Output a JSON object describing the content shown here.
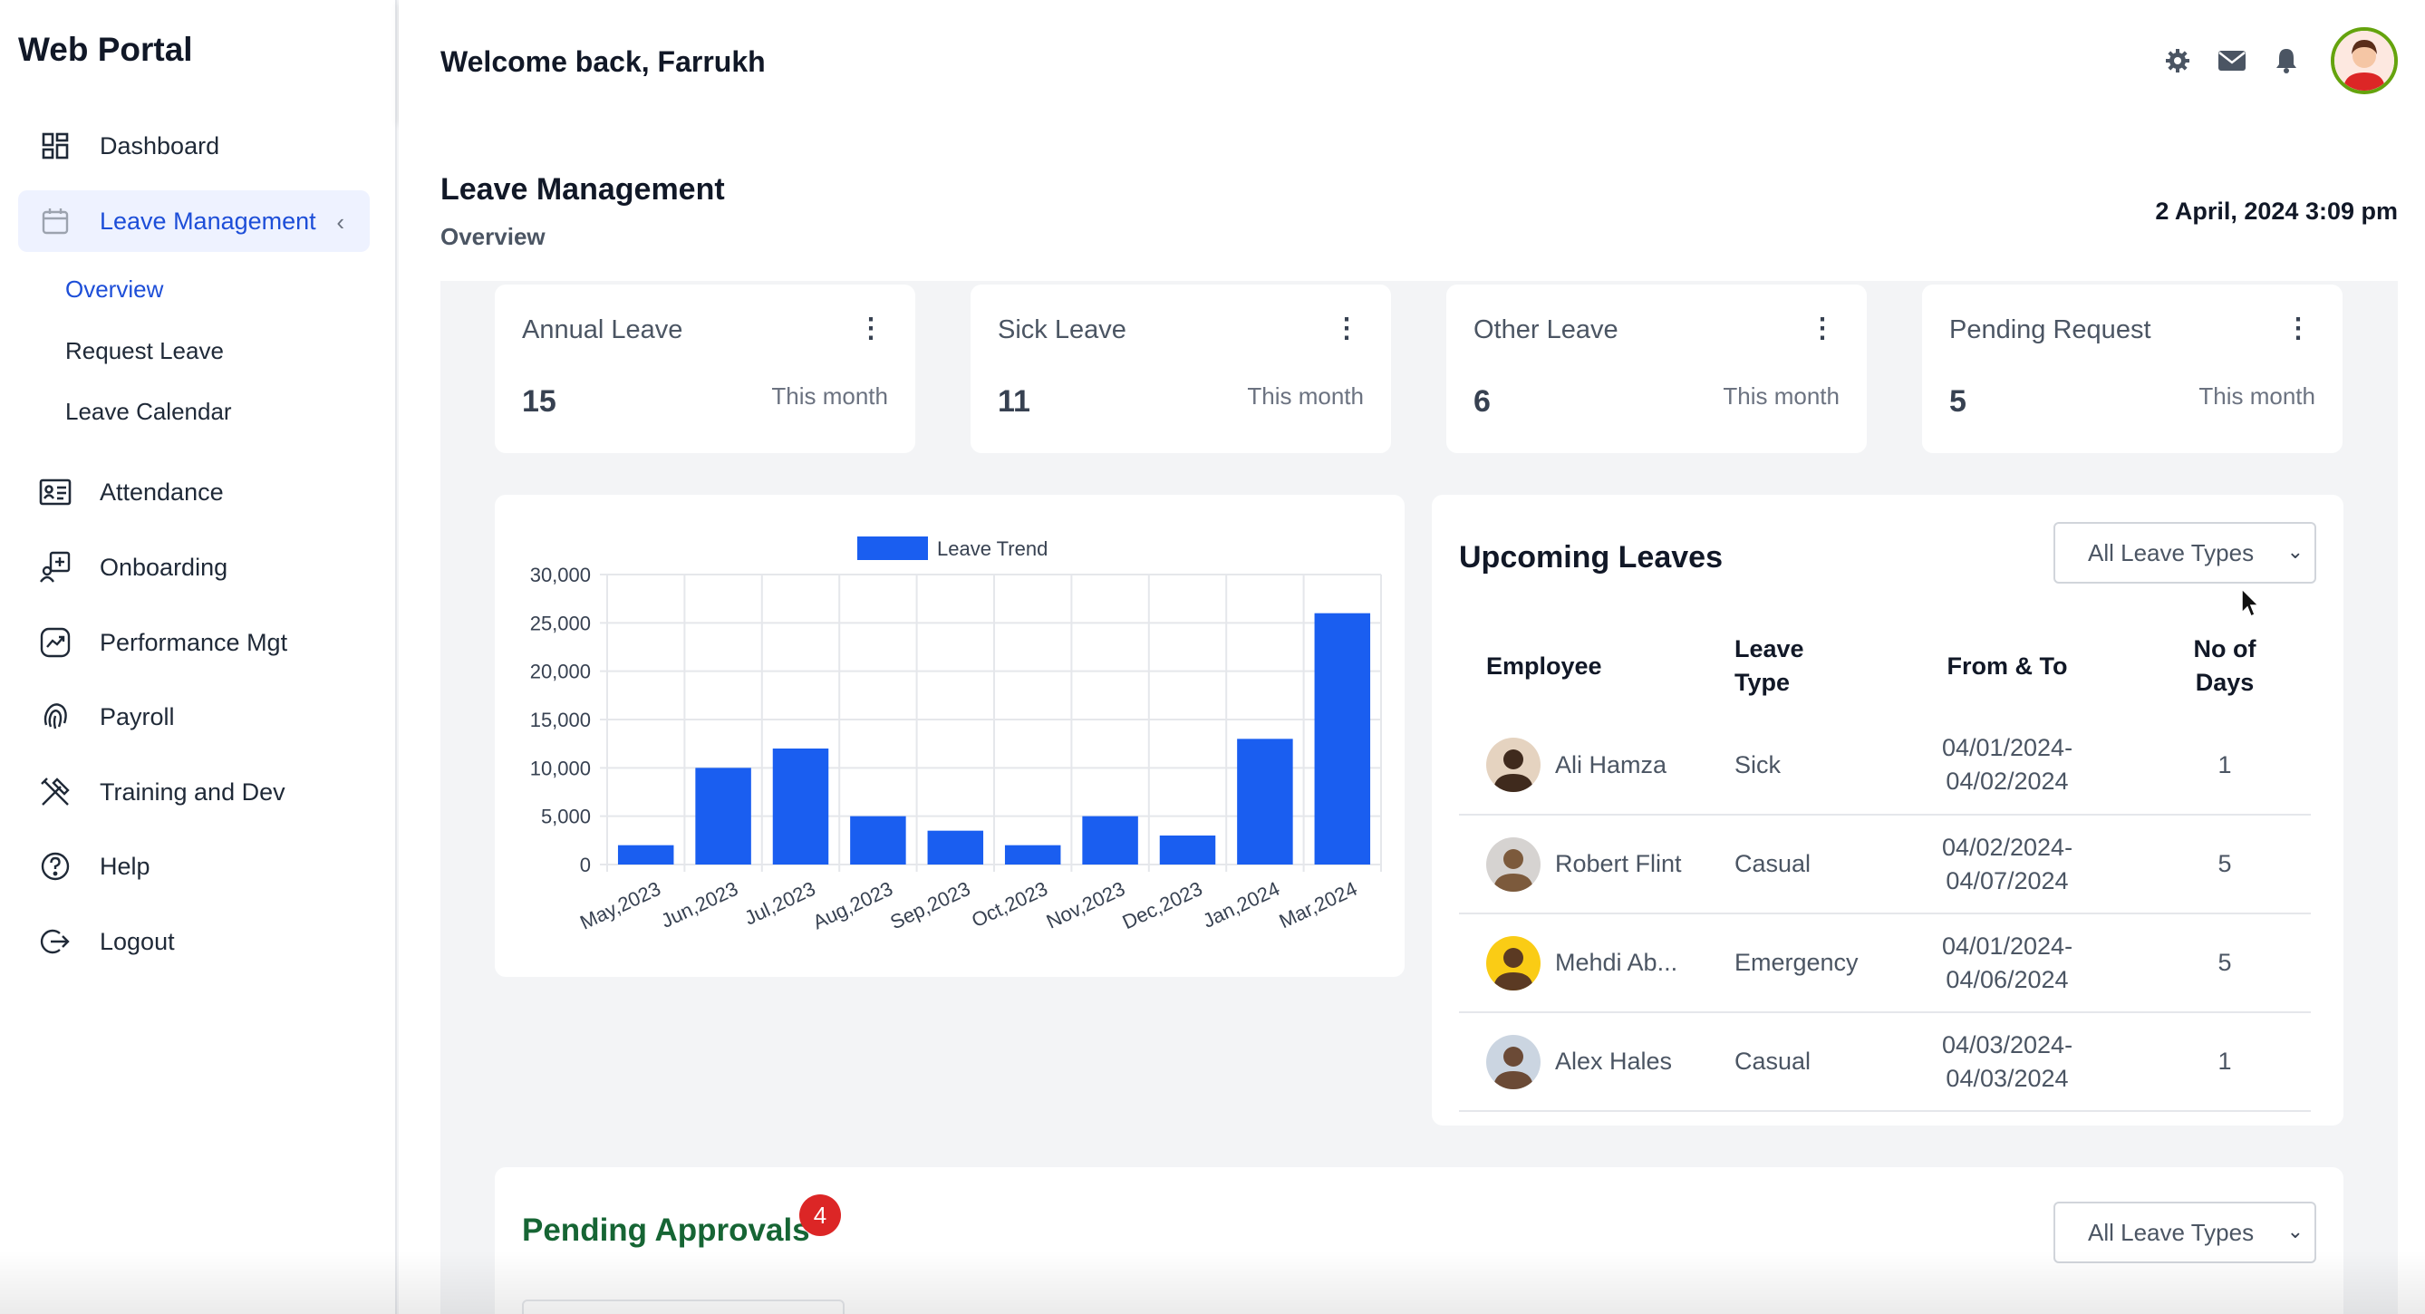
{
  "app": {
    "brand": "Web Portal"
  },
  "sidebar": {
    "items": [
      {
        "label": "Dashboard",
        "icon": "dashboard-icon"
      },
      {
        "label": "Leave Management",
        "icon": "calendar-icon",
        "active": true
      },
      {
        "label": "Attendance",
        "icon": "id-card-icon"
      },
      {
        "label": "Onboarding",
        "icon": "onboarding-icon"
      },
      {
        "label": "Performance Mgt",
        "icon": "trend-chart-icon"
      },
      {
        "label": "Payroll",
        "icon": "fingerprint-icon"
      },
      {
        "label": "Training and Dev",
        "icon": "tools-icon"
      },
      {
        "label": "Help",
        "icon": "help-circle-icon"
      },
      {
        "label": "Logout",
        "icon": "logout-icon"
      }
    ],
    "subitems": [
      {
        "label": "Overview",
        "active": true
      },
      {
        "label": "Request Leave"
      },
      {
        "label": "Leave Calendar"
      }
    ]
  },
  "header": {
    "welcome": "Welcome back, Farrukh",
    "icons": [
      "gear-icon",
      "mail-icon",
      "bell-icon",
      "user-avatar"
    ]
  },
  "page": {
    "title": "Leave Management",
    "subtitle": "Overview",
    "datetime": "2 April, 2024 3:09 pm"
  },
  "stats": [
    {
      "title": "Annual Leave",
      "value": "15",
      "period": "This month"
    },
    {
      "title": "Sick Leave",
      "value": "11",
      "period": "This month"
    },
    {
      "title": "Other Leave",
      "value": "6",
      "period": "This month"
    },
    {
      "title": "Pending Request",
      "value": "5",
      "period": "This month"
    }
  ],
  "chart_data": {
    "type": "bar",
    "categories": [
      "May,2023",
      "Jun,2023",
      "Jul,2023",
      "Aug,2023",
      "Sep,2023",
      "Oct,2023",
      "Nov,2023",
      "Dec,2023",
      "Jan,2024",
      "Mar,2024"
    ],
    "series": [
      {
        "name": "Leave Trend",
        "values": [
          2000,
          10000,
          12000,
          5000,
          3500,
          2000,
          5000,
          3000,
          13000,
          26000
        ],
        "color": "#1a5ef0"
      }
    ],
    "yticks": [
      "0",
      "5,000",
      "10,000",
      "15,000",
      "20,000",
      "25,000",
      "30,000"
    ],
    "ylim": [
      0,
      30000
    ],
    "grid": true,
    "legend": "top-center"
  },
  "upcoming": {
    "title": "Upcoming Leaves",
    "filter": "All Leave Types",
    "columns": [
      "Employee",
      "Leave Type",
      "From & To",
      "No of Days"
    ],
    "rows": [
      {
        "employee": "Ali Hamza",
        "type": "Sick",
        "from": "04/01/2024-",
        "to": "04/02/2024",
        "days": "1"
      },
      {
        "employee": "Robert Flint",
        "type": "Casual",
        "from": "04/02/2024-",
        "to": "04/07/2024",
        "days": "5"
      },
      {
        "employee": "Mehdi Ab...",
        "type": "Emergency",
        "from": "04/01/2024-",
        "to": "04/06/2024",
        "days": "5"
      },
      {
        "employee": "Alex Hales",
        "type": "Casual",
        "from": "04/03/2024-",
        "to": "04/03/2024",
        "days": "1"
      }
    ]
  },
  "pending": {
    "title": "Pending Approvals",
    "count": "4",
    "filter": "All Leave Types"
  }
}
